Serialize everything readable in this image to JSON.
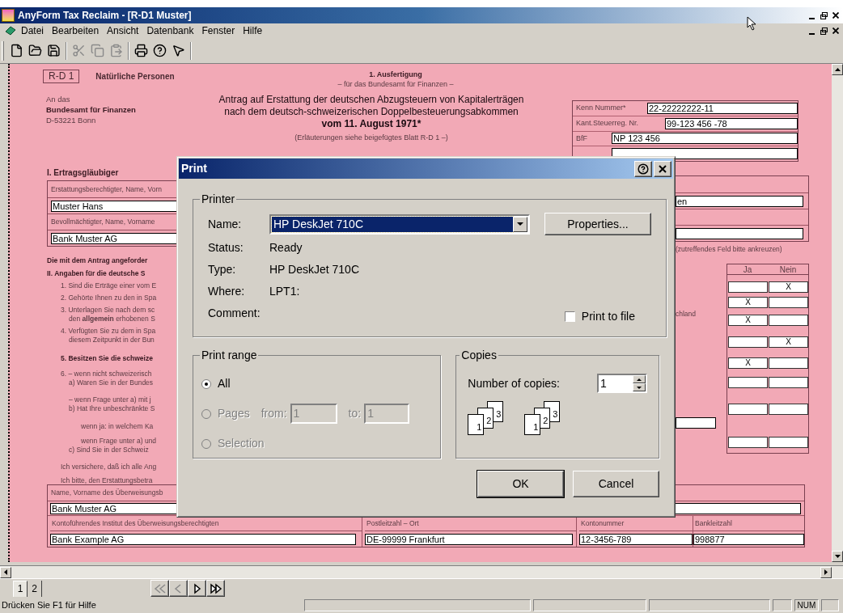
{
  "window": {
    "title": "AnyForm Tax Reclaim - [R-D1 Muster]"
  },
  "menu": [
    "Datei",
    "Bearbeiten",
    "Ansicht",
    "Datenbank",
    "Fenster",
    "Hilfe"
  ],
  "toolbar": [
    [
      {
        "kind": "new",
        "disabled": false
      },
      {
        "kind": "open",
        "disabled": false
      },
      {
        "kind": "save",
        "disabled": false
      }
    ],
    [
      {
        "kind": "cut",
        "disabled": true
      },
      {
        "kind": "copy",
        "disabled": true
      },
      {
        "kind": "paste",
        "disabled": true
      }
    ],
    [
      {
        "kind": "print",
        "disabled": false
      },
      {
        "kind": "help",
        "disabled": false
      },
      {
        "kind": "context_help",
        "disabled": false
      }
    ]
  ],
  "form": {
    "code": "R-D 1",
    "category": "Natürliche Personen",
    "address": [
      {
        "text": "An das",
        "bold": false
      },
      {
        "text": "Bundesamt für Finanzen",
        "bold": true
      },
      {
        "text": "D-53221 Bonn",
        "bold": false
      }
    ],
    "copy": "1. Ausfertigung",
    "copy_note": "– für das Bundesamt für Finanzen –",
    "title": [
      "Antrag auf Erstattung der deutschen Abzugsteuern von Kapitalerträgen",
      "nach dem deutsch-schweizerischen Doppelbesteuerungsabkommen",
      "vom 11. August 1971*"
    ],
    "note": "(Erläuterungen siehe beigefügtes Blatt R-D 1 –)",
    "ids": [
      {
        "label": "Kenn Nummer*",
        "value": "22-22222222-11"
      },
      {
        "label": "Kant.Steuerreg. Nr.",
        "value": "99-123 456 -78"
      },
      {
        "label": "BfF",
        "value": "NP 123 456"
      }
    ],
    "section1_heading": "I.  Ertragsgläubiger",
    "parties": [
      {
        "label": "Erstattungsberechtigter, Name, Vorn",
        "value": "Muster Hans",
        "value_right": "en"
      },
      {
        "label": "Bevollmächtigter, Name, Vorname",
        "value": "Bank Muster AG"
      }
    ],
    "lines": [
      {
        "kind": "bold",
        "text": "Die mit dem Antrag angeforder"
      },
      {
        "kind": "bold",
        "text": "II.  Angaben für die deutsche S"
      },
      {
        "kind": "item",
        "text": "1. Sind die Erträge einer vom E"
      },
      {
        "kind": "item",
        "text": "2. Gehörte Ihnen zu den in Spa"
      },
      {
        "kind": "item",
        "text": "3. Unterlagen Sie nach dem sc"
      },
      {
        "kind": "sub",
        "text": "den **allgemein** erhobenen S"
      },
      {
        "kind": "item",
        "text": "4. Verfügten Sie zu dem in Spa"
      },
      {
        "kind": "sub",
        "text": "diesem Zeitpunkt in der Bun"
      },
      {
        "kind": "item_bold",
        "text": "5. Besitzen Sie die schweize"
      },
      {
        "kind": "item",
        "text": "6. –  wenn nicht schweizerisch"
      },
      {
        "kind": "sub",
        "text": "a)  Waren Sie in der Bundes"
      },
      {
        "kind": "sub",
        "text": "–  wenn Frage unter a) mit j"
      },
      {
        "kind": "sub",
        "text": "b)  Hat Ihre unbeschränkte S"
      },
      {
        "kind": "subsub",
        "text": "wenn ja: in welchem Ka"
      },
      {
        "kind": "subsub",
        "text": "wenn Frage unter a) und"
      },
      {
        "kind": "sub",
        "text": "c)  Sind Sie in der Schweiz"
      },
      {
        "kind": "item",
        "text": "Ich versichere, daß ich alle Ang"
      },
      {
        "kind": "item",
        "text": "Ich bitte, den Erstattungsbetra"
      }
    ],
    "instruction": "(zutreffendes Feld bitte ankreuzen)",
    "side_text": "chland",
    "answer_columns": [
      "Ja",
      "Nein"
    ],
    "answers": [
      {
        "yes": false,
        "no": true,
        "mark": "X"
      },
      {
        "yes": true,
        "no": false,
        "mark": "X"
      },
      {
        "yes": true,
        "no": false,
        "mark": "X"
      },
      {
        "yes": false,
        "no": true,
        "mark": "X"
      },
      {
        "yes": true,
        "no": false,
        "mark": "X"
      },
      {
        "yes": false,
        "no": false
      },
      {
        "yes": false,
        "no": false
      },
      {
        "yes": false,
        "no": false
      }
    ],
    "payee_label": "Name, Vorname des Überweisungsb",
    "payee_value": "Bank Muster AG",
    "bank_columns": [
      {
        "label": "Kontoführendes Institut des Überweisungsberechtigten",
        "value": "Bank Example AG"
      },
      {
        "label": "Postleitzahl – Ort",
        "value": "DE-99999 Frankfurt"
      },
      {
        "label": "Kontonummer",
        "value": "12-3456-789"
      },
      {
        "label": "Bankleitzahl",
        "value": "998877"
      }
    ]
  },
  "dialog": {
    "title": "Print",
    "printer": {
      "legend": "Printer",
      "name_label": "Name:",
      "name_value": "HP DeskJet 710C",
      "name_focused": true,
      "properties": "Properties...",
      "info": [
        {
          "label": "Status:",
          "value": "Ready"
        },
        {
          "label": "Type:",
          "value": "HP DeskJet 710C"
        },
        {
          "label": "Where:",
          "value": "LPT1:"
        },
        {
          "label": "Comment:"
        }
      ],
      "print_to_file": {
        "label": "Print to file",
        "checked": false
      }
    },
    "print_range": {
      "legend": "Print range",
      "options": [
        {
          "label": "All",
          "selected": true,
          "disabled": false
        },
        {
          "label": "Pages",
          "selected": false,
          "disabled": true
        },
        {
          "label": "Selection",
          "selected": false,
          "disabled": true
        }
      ],
      "from_label": "from:",
      "from_value": "1",
      "to_label": "to:",
      "to_value": "1"
    },
    "copies": {
      "legend": "Copies",
      "label": "Number of copies:",
      "value": "1",
      "collate_icons": [
        [
          "1",
          "2",
          "3"
        ],
        [
          "1",
          "2",
          "3"
        ]
      ]
    },
    "buttons": [
      "OK",
      "Cancel"
    ]
  },
  "page_tabs": [
    {
      "label": "1",
      "selected": true
    },
    {
      "label": "2",
      "selected": false
    }
  ],
  "page_nav": [
    {
      "kind": "first",
      "disabled": true
    },
    {
      "kind": "prev",
      "disabled": true
    },
    {
      "kind": "next",
      "disabled": false
    },
    {
      "kind": "last",
      "disabled": false
    }
  ],
  "status_bar": {
    "text": "Drücken Sie F1 für Hilfe",
    "indicator": "NUM"
  }
}
